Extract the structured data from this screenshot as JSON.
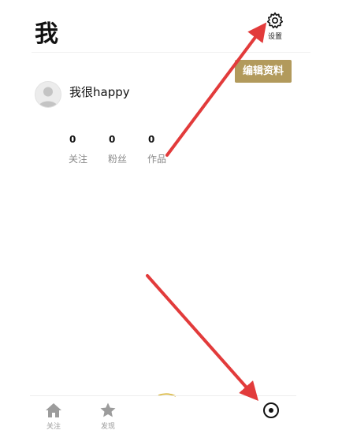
{
  "header": {
    "title": "我",
    "settings_label": "设置"
  },
  "profile": {
    "username": "我很happy",
    "edit_label": "编辑资料"
  },
  "stats": [
    {
      "value": "0",
      "label": "关注"
    },
    {
      "value": "0",
      "label": "粉丝"
    },
    {
      "value": "0",
      "label": "作品"
    }
  ],
  "tabbar": {
    "items": [
      {
        "label": "关注",
        "icon": "home-icon"
      },
      {
        "label": "发现",
        "icon": "star-icon"
      },
      {
        "label": "",
        "icon": "me-icon"
      }
    ]
  },
  "colors": {
    "edit_button": "#b29a5c",
    "annotation_arrow": "#e23b3b"
  }
}
